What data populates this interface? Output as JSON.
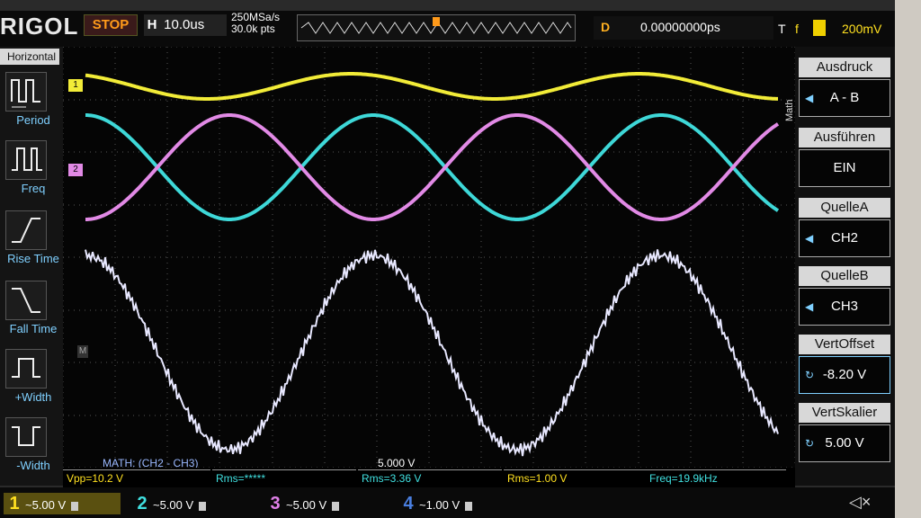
{
  "brand": "RIGOL",
  "header": {
    "run_state": "STOP",
    "timebase_label": "H",
    "timebase_value": "10.0us",
    "sample_rate": "250MSa/s",
    "memory_depth": "30.0k pts",
    "delay_label": "D",
    "delay_value": "0.00000000ps",
    "trigger_label": "T",
    "trigger_slope": "f",
    "trigger_level": "200mV"
  },
  "left_menu": {
    "title": "Horizontal",
    "items": [
      {
        "label": "Period"
      },
      {
        "label": "Freq"
      },
      {
        "label": "Rise Time"
      },
      {
        "label": "Fall Time"
      },
      {
        "label": "+Width"
      },
      {
        "label": "-Width"
      }
    ]
  },
  "right_menu": {
    "side_tag": "Math",
    "items": [
      {
        "header": "Ausdruck",
        "value": "A - B"
      },
      {
        "header": "Ausführen",
        "value": "EIN"
      },
      {
        "header": "QuelleA",
        "value": "CH2"
      },
      {
        "header": "QuelleB",
        "value": "CH3"
      },
      {
        "header": "VertOffset",
        "value": "-8.20 V"
      },
      {
        "header": "VertSkalier",
        "value": "5.00 V"
      }
    ]
  },
  "screen": {
    "math_label": "MATH: (CH2 - CH3)",
    "math_scale": "5.000 V",
    "ch1_marker": "1",
    "ch2_marker": "2",
    "math_marker": "M"
  },
  "measurements": [
    {
      "text": "Vpp=10.2 V",
      "color": "#ffe020"
    },
    {
      "text": "Rms=*****",
      "color": "#40e0e0"
    },
    {
      "text": "Rms=3.36 V",
      "color": "#40e0e0"
    },
    {
      "text": "Rms=1.00 V",
      "color": "#ffe020"
    },
    {
      "text": "Freq=19.9kHz",
      "color": "#40e0e0"
    }
  ],
  "channels": [
    {
      "num": "1",
      "scale": "~5.00 V",
      "color": "#ffe020"
    },
    {
      "num": "2",
      "scale": "~5.00 V",
      "color": "#40e0e0"
    },
    {
      "num": "3",
      "scale": "~5.00 V",
      "color": "#e080e8"
    },
    {
      "num": "4",
      "scale": "~1.00 V",
      "color": "#4a7fe0"
    }
  ],
  "colors": {
    "ch1": "#f2ec38",
    "ch2": "#3ed8d8",
    "ch3": "#e28ae6",
    "math": "#e8e8ff",
    "grid": "#555555"
  }
}
